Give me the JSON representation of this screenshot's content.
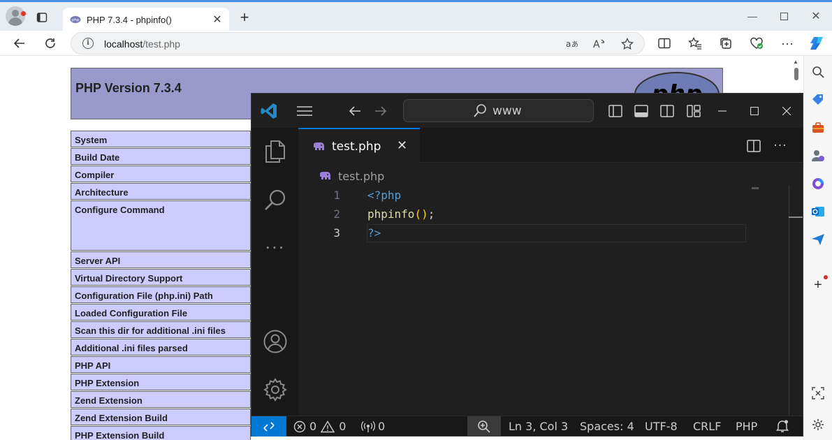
{
  "browser": {
    "tab_title": "PHP 7.3.4 - phpinfo()",
    "url_host": "localhost",
    "url_path": "/test.php"
  },
  "php_page": {
    "version_title": "PHP Version 7.3.4",
    "logo_text": "php",
    "rows": [
      "System",
      "Build Date",
      "Compiler",
      "Architecture",
      "Configure Command",
      "Server API",
      "Virtual Directory Support",
      "Configuration File (php.ini) Path",
      "Loaded Configuration File",
      "Scan this dir for additional .ini files",
      "Additional .ini files parsed",
      "PHP API",
      "PHP Extension",
      "Zend Extension",
      "Zend Extension Build",
      "PHP Extension Build"
    ]
  },
  "vscode": {
    "search_label": "www",
    "tab_label": "test.php",
    "breadcrumb": "test.php",
    "lines": [
      {
        "num": "1",
        "text": "<?php"
      },
      {
        "num": "2",
        "fn": "phpinfo",
        "parens": "()",
        "semi": ";"
      },
      {
        "num": "3",
        "text": "?>"
      }
    ],
    "status": {
      "errors": "0",
      "warnings": "0",
      "ports": "0",
      "position": "Ln 3, Col 3",
      "spaces": "Spaces: 4",
      "encoding": "UTF-8",
      "eol": "CRLF",
      "language": "PHP"
    },
    "colors": {
      "accent": "#0078d4",
      "keyword": "#569cd6",
      "function": "#dcdcaa",
      "paren": "#ffd700",
      "php_purple": "#9999cc"
    }
  },
  "icons": {
    "browser": [
      "profile-icon",
      "tab-actions-icon",
      "php-favicon",
      "close-icon",
      "plus-icon",
      "minimize-icon",
      "maximize-icon",
      "back-icon",
      "refresh-icon",
      "info-icon",
      "translate-icon",
      "read-aloud-icon",
      "star-icon",
      "split-screen-icon",
      "favorites-icon",
      "collections-icon",
      "browser-essentials-icon",
      "more-icon",
      "copilot-icon"
    ],
    "sidebar": [
      "search-icon",
      "shopping-icon",
      "tools-icon",
      "people-icon",
      "office-icon",
      "outlook-icon",
      "send-icon",
      "add-icon",
      "screenshot-icon",
      "settings-icon"
    ]
  }
}
